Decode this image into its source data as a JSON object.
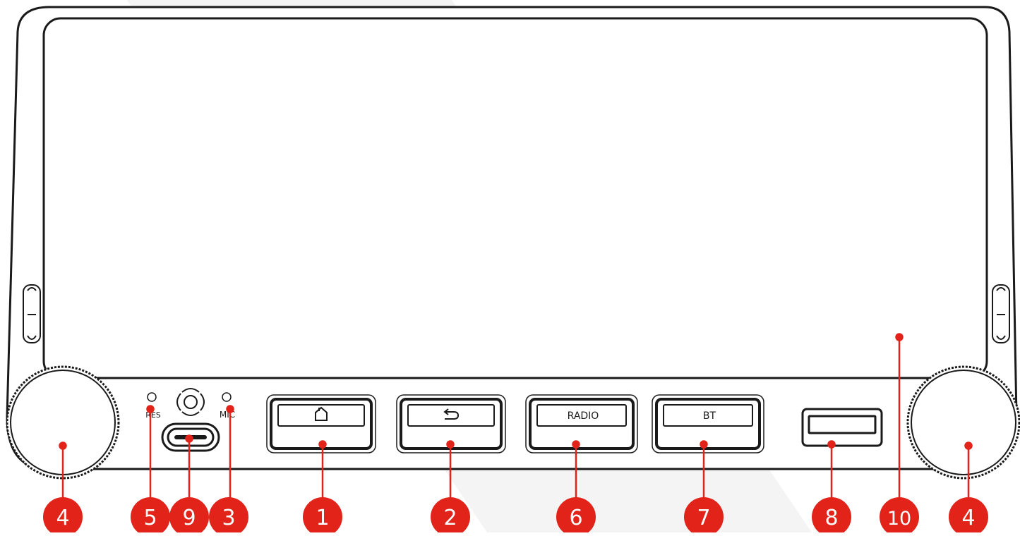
{
  "buttons": {
    "home_icon": "home-icon",
    "back_icon": "back-arrow-icon",
    "radio_label": "RADIO",
    "bt_label": "BT"
  },
  "panel_labels": {
    "reset": "RES",
    "mic": "MIC",
    "gps_icon": "gps-crosshair-icon"
  },
  "callouts": {
    "knob_left": "4",
    "reset_hole": "5",
    "usb_c_port": "9",
    "microphone": "3",
    "home_button": "1",
    "back_button": "2",
    "radio_button": "6",
    "bt_button": "7",
    "usb_a_port": "8",
    "screen": "10",
    "knob_right": "4"
  },
  "colors": {
    "callout_red": "#e2231a",
    "outline": "#1a1a1a",
    "surface": "#ffffff"
  }
}
